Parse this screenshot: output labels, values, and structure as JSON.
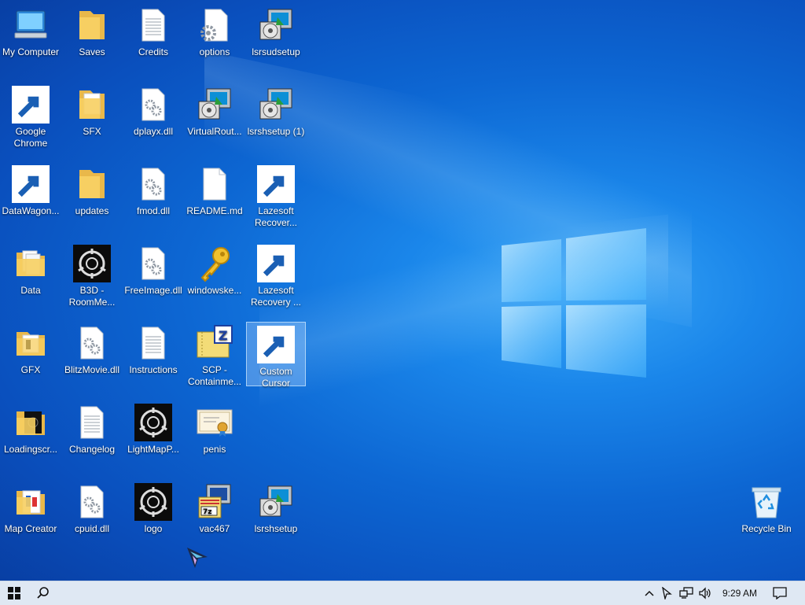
{
  "desktop": {
    "icons": [
      {
        "id": "my-computer",
        "label": "My Computer",
        "icon": "monitor-icon"
      },
      {
        "id": "saves",
        "label": "Saves",
        "icon": "folder-icon"
      },
      {
        "id": "credits",
        "label": "Credits",
        "icon": "text-document-icon"
      },
      {
        "id": "options",
        "label": "options",
        "icon": "config-file-icon"
      },
      {
        "id": "lsrsudsetup",
        "label": "lsrsudsetup",
        "icon": "installer-icon"
      },
      {
        "id": "google-chrome",
        "label": "Google Chrome",
        "icon": "chrome-icon"
      },
      {
        "id": "sfx",
        "label": "SFX",
        "icon": "folder-icon"
      },
      {
        "id": "dplayx",
        "label": "dplayx.dll",
        "icon": "dll-icon"
      },
      {
        "id": "virtualrout",
        "label": "VirtualRout...",
        "icon": "installer-icon"
      },
      {
        "id": "lsrshsetup-1",
        "label": "lsrshsetup (1)",
        "icon": "installer-icon"
      },
      {
        "id": "datawagon",
        "label": "DataWagon...",
        "icon": "datawagon-icon"
      },
      {
        "id": "updates",
        "label": "updates",
        "icon": "folder-icon"
      },
      {
        "id": "fmod",
        "label": "fmod.dll",
        "icon": "dll-icon"
      },
      {
        "id": "readme",
        "label": "README.md",
        "icon": "blank-document-icon"
      },
      {
        "id": "lazesoft-1",
        "label": "Lazesoft Recover...",
        "icon": "lazesoft-icon"
      },
      {
        "id": "data",
        "label": "Data",
        "icon": "folder-documents-icon"
      },
      {
        "id": "b3d",
        "label": "B3D - RoomMe...",
        "icon": "scp-logo-icon"
      },
      {
        "id": "freeimage",
        "label": "FreeImage.dll",
        "icon": "dll-icon"
      },
      {
        "id": "windowske",
        "label": "windowske...",
        "icon": "key-icon"
      },
      {
        "id": "lazesoft-2",
        "label": "Lazesoft Recovery ...",
        "icon": "lazesoft-icon"
      },
      {
        "id": "gfx",
        "label": "GFX",
        "icon": "folder-image-icon"
      },
      {
        "id": "blitzmovie",
        "label": "BlitzMovie.dll",
        "icon": "dll-icon"
      },
      {
        "id": "instructions",
        "label": "Instructions",
        "icon": "text-document-icon"
      },
      {
        "id": "scp-containment",
        "label": "SCP - Containme...",
        "icon": "zip-archive-icon"
      },
      {
        "id": "custom-cursor",
        "label": "Custom Cursor",
        "icon": "cursor-arrow-icon"
      },
      {
        "id": "loadingscr",
        "label": "Loadingscr...",
        "icon": "folder-dark-icon"
      },
      {
        "id": "changelog",
        "label": "Changelog",
        "icon": "text-document-icon"
      },
      {
        "id": "lightmapp",
        "label": "LightMapP...",
        "icon": "scp-logo-icon"
      },
      {
        "id": "penis",
        "label": "penis",
        "icon": "certificate-icon"
      },
      {
        "id": "map-creator",
        "label": "Map Creator",
        "icon": "folder-map-icon"
      },
      {
        "id": "cpuid",
        "label": "cpuid.dll",
        "icon": "dll-icon"
      },
      {
        "id": "logo",
        "label": "logo",
        "icon": "scp-logo-icon"
      },
      {
        "id": "vac467",
        "label": "vac467",
        "icon": "7zip-installer-icon"
      },
      {
        "id": "lsrshsetup",
        "label": "lsrshsetup",
        "icon": "installer-icon"
      },
      {
        "id": "recycle-bin",
        "label": "Recycle Bin",
        "icon": "recycle-bin-icon"
      }
    ],
    "selected_icon": "Custom Cursor"
  },
  "taskbar": {
    "start_icon": "windows-start-icon",
    "search_icon": "search-icon",
    "tray": {
      "clock_time": "9:29 AM",
      "chevron_icon": "chevron-up-icon",
      "cursor_app_icon": "cursor-tray-icon",
      "network_icon": "network-icon",
      "volume_icon": "volume-icon",
      "notification_icon": "notification-icon"
    }
  },
  "colors": {
    "wallpaper_blue": "#0d67d3",
    "wallpaper_light": "#3aa7f7",
    "taskbar": "#dfe8f3",
    "selection": "#aad2ff"
  }
}
